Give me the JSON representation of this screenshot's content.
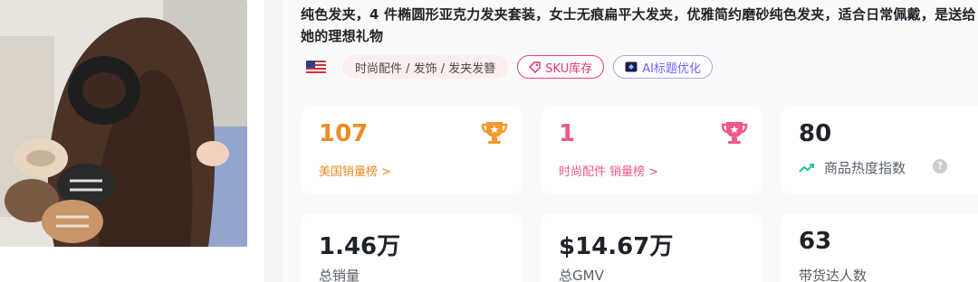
{
  "product": {
    "title": "纯色发夹，4 件椭圆形亚克力发夹套装，女士无痕扁平大发夹，优雅简约磨砂纯色发夹，适合日常佩戴，是送给她的理想礼物",
    "image_alt": "product-photo"
  },
  "tags": {
    "country_flag": "us-flag-icon",
    "category": "时尚配件 / 发饰 / 发夹发簪",
    "sku_button": "SKU库存",
    "ai_button": "AI标题优化"
  },
  "stats": {
    "us_rank": {
      "value": "107",
      "label": "美国销量榜 >"
    },
    "category_rank": {
      "value": "1",
      "label": "时尚配件 销量榜 >"
    },
    "heat": {
      "value": "80",
      "label": "商品热度指数",
      "help": "?"
    },
    "total_sales": {
      "value": "1.46万",
      "label": "总销量"
    },
    "total_gmv": {
      "value": "$14.67万",
      "label": "总GMV"
    },
    "creators": {
      "value": "63",
      "label": "带货达人数"
    }
  },
  "colors": {
    "accent_orange": "#f08a24",
    "accent_pink": "#f0578a",
    "trend_green": "#1fc4a0"
  }
}
